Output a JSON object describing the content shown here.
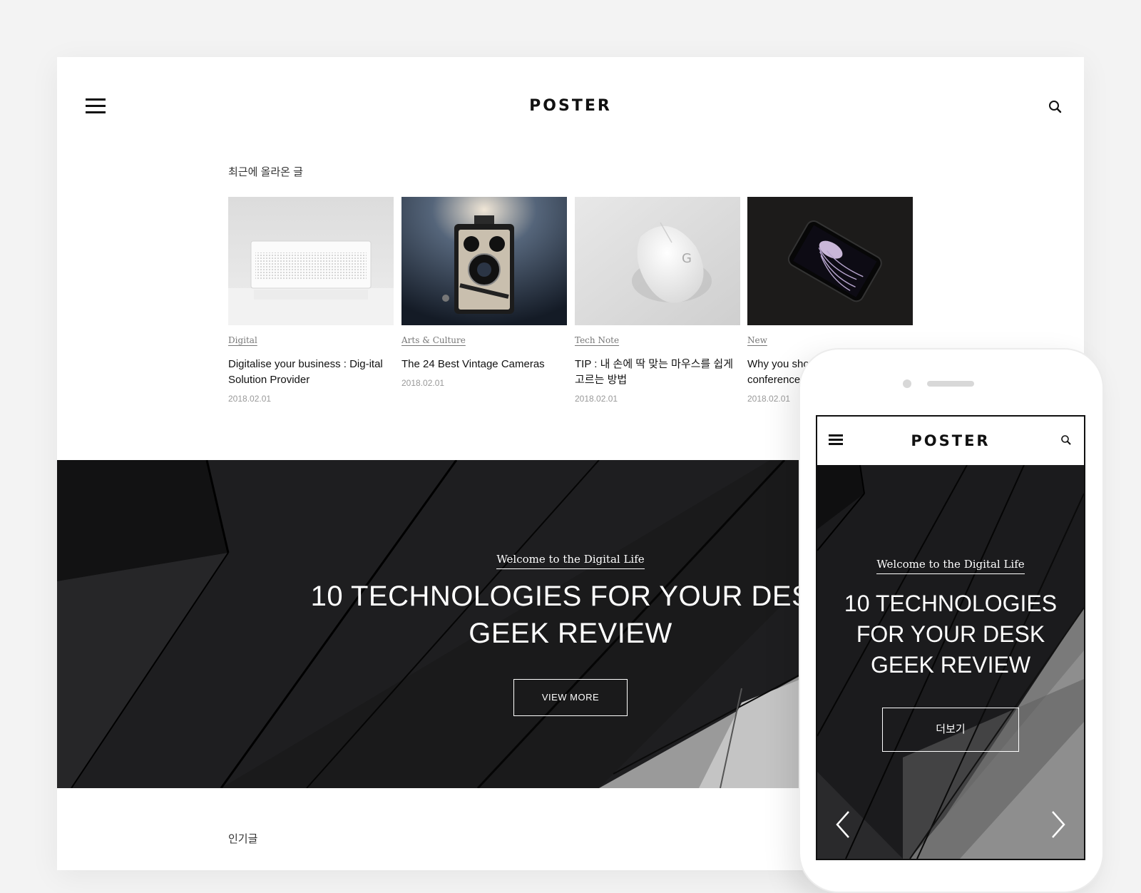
{
  "site": {
    "logo": "POSTER"
  },
  "recent": {
    "label": "최근에 올라온 글",
    "items": [
      {
        "category": "Digital",
        "title": "Digitalise your business : Dig-ital Solution Provider",
        "date": "2018.02.01",
        "image": "white-speaker-photo"
      },
      {
        "category": "Arts & Culture",
        "title": "The 24 Best Vintage Cameras",
        "date": "2018.02.01",
        "image": "vintage-camera-photo"
      },
      {
        "category": "Tech Note",
        "title": "TIP : 내 손에 딱 맞는 마우스를 쉽게 고르는 방법",
        "date": "2018.02.01",
        "image": "white-mouse-photo"
      },
      {
        "category": "New",
        "title": "Why you should attend the tech conference",
        "date": "2018.02.01",
        "image": "smartphone-jellyfish-photo"
      }
    ]
  },
  "hero": {
    "kicker": "Welcome to the Digital Life",
    "title_line1": "10 TECHNOLOGIES FOR YOUR DESK",
    "title_line2": "GEEK REVIEW",
    "button": "VIEW MORE"
  },
  "popular": {
    "label": "인기글"
  },
  "mobile": {
    "logo": "POSTER",
    "kicker": "Welcome to the Digital Life",
    "title_line1": "10 TECHNOLOGIES",
    "title_line2": "FOR YOUR DESK",
    "title_line3": "GEEK REVIEW",
    "button": "더보기"
  },
  "icons": [
    "hamburger-icon",
    "search-icon",
    "chevron-left-icon",
    "chevron-right-icon"
  ],
  "colors": {
    "hero_bg": "#1e1e20",
    "text": "#111111",
    "muted": "#999999",
    "page_bg": "#f3f3f3"
  }
}
